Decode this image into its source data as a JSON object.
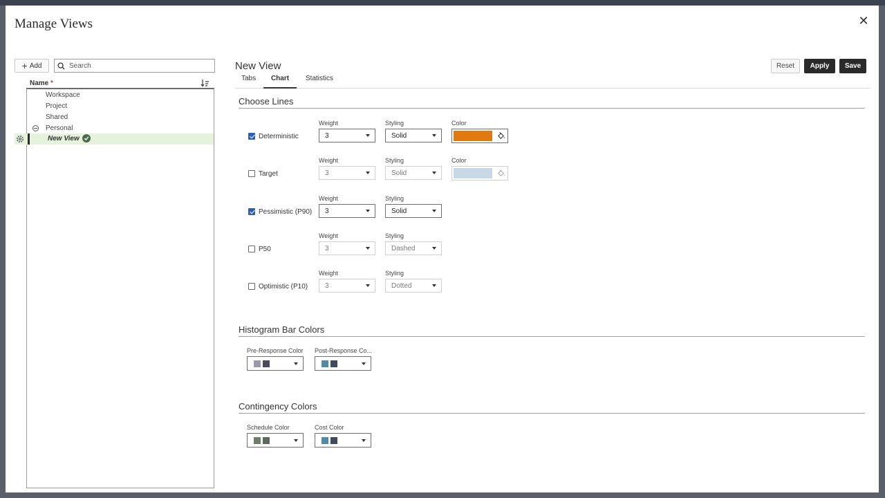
{
  "dialog": {
    "title": "Manage Views",
    "close": "✕"
  },
  "left": {
    "add_label": "Add",
    "search_placeholder": "Search",
    "name_header": "Name",
    "required_mark": "*",
    "tree": [
      "Workspace",
      "Project",
      "Shared",
      "Personal"
    ],
    "selected": "New View"
  },
  "right": {
    "title": "New View",
    "reset": "Reset",
    "apply": "Apply",
    "save": "Save",
    "tabs": [
      "Tabs",
      "Chart",
      "Statistics"
    ],
    "active_tab": "Chart"
  },
  "lines": {
    "section": "Choose Lines",
    "weight_label": "Weight",
    "styling_label": "Styling",
    "color_label": "Color",
    "rows": [
      {
        "label": "Deterministic",
        "checked": true,
        "weight": "3",
        "styling": "Solid",
        "color": "#e07a10"
      },
      {
        "label": "Target",
        "checked": false,
        "weight": "3",
        "styling": "Solid",
        "color": "#c9d8e6"
      },
      {
        "label": "Pessimistic (P90)",
        "checked": true,
        "weight": "3",
        "styling": "Solid"
      },
      {
        "label": "P50",
        "checked": false,
        "weight": "3",
        "styling": "Dashed"
      },
      {
        "label": "Optimistic (P10)",
        "checked": false,
        "weight": "3",
        "styling": "Dotted"
      }
    ]
  },
  "histogram": {
    "section": "Histogram Bar Colors",
    "pre_label": "Pre-Response Color",
    "post_label": "Post-Response Co...",
    "pre_colors": [
      "#9a97ae",
      "#4b4a5e"
    ],
    "post_colors": [
      "#4f8aa6",
      "#3f4a5e"
    ]
  },
  "contingency": {
    "section": "Contingency Colors",
    "schedule_label": "Schedule Color",
    "cost_label": "Cost Color",
    "schedule_colors": [
      "#6b7e6a",
      "#5b6b5a"
    ],
    "cost_colors": [
      "#4f8aa6",
      "#3f4a5e"
    ]
  }
}
